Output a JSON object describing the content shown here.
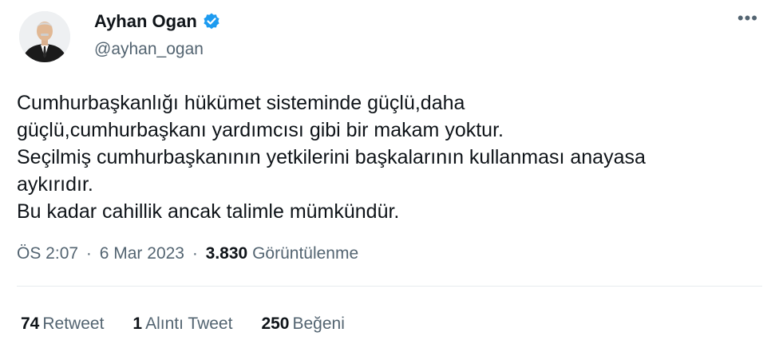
{
  "author": {
    "name": "Ayhan Ogan",
    "handle": "@ayhan_ogan",
    "verified_color": "#1d9bf0"
  },
  "menu_icon": "more-horizontal-icon",
  "tweet": {
    "lines": [
      "Cumhurbaşkanlığı hükümet sisteminde güçlü,daha",
      "güçlü,cumhurbaşkanı yardımcısı gibi bir makam yoktur.",
      "Seçilmiş cumhurbaşkanının yetkilerini başkalarının kullanması anayasa",
      "aykırıdır.",
      "Bu kadar cahillik ancak talimle mümkündür."
    ]
  },
  "meta": {
    "time": "ÖS 2:07",
    "date": "6 Mar 2023",
    "views_count": "3.830",
    "views_label": "Görüntülenme",
    "separator": "·"
  },
  "stats": {
    "retweets_count": "74",
    "retweets_label": "Retweet",
    "quotes_count": "1",
    "quotes_label": "Alıntı Tweet",
    "likes_count": "250",
    "likes_label": "Beğeni"
  }
}
